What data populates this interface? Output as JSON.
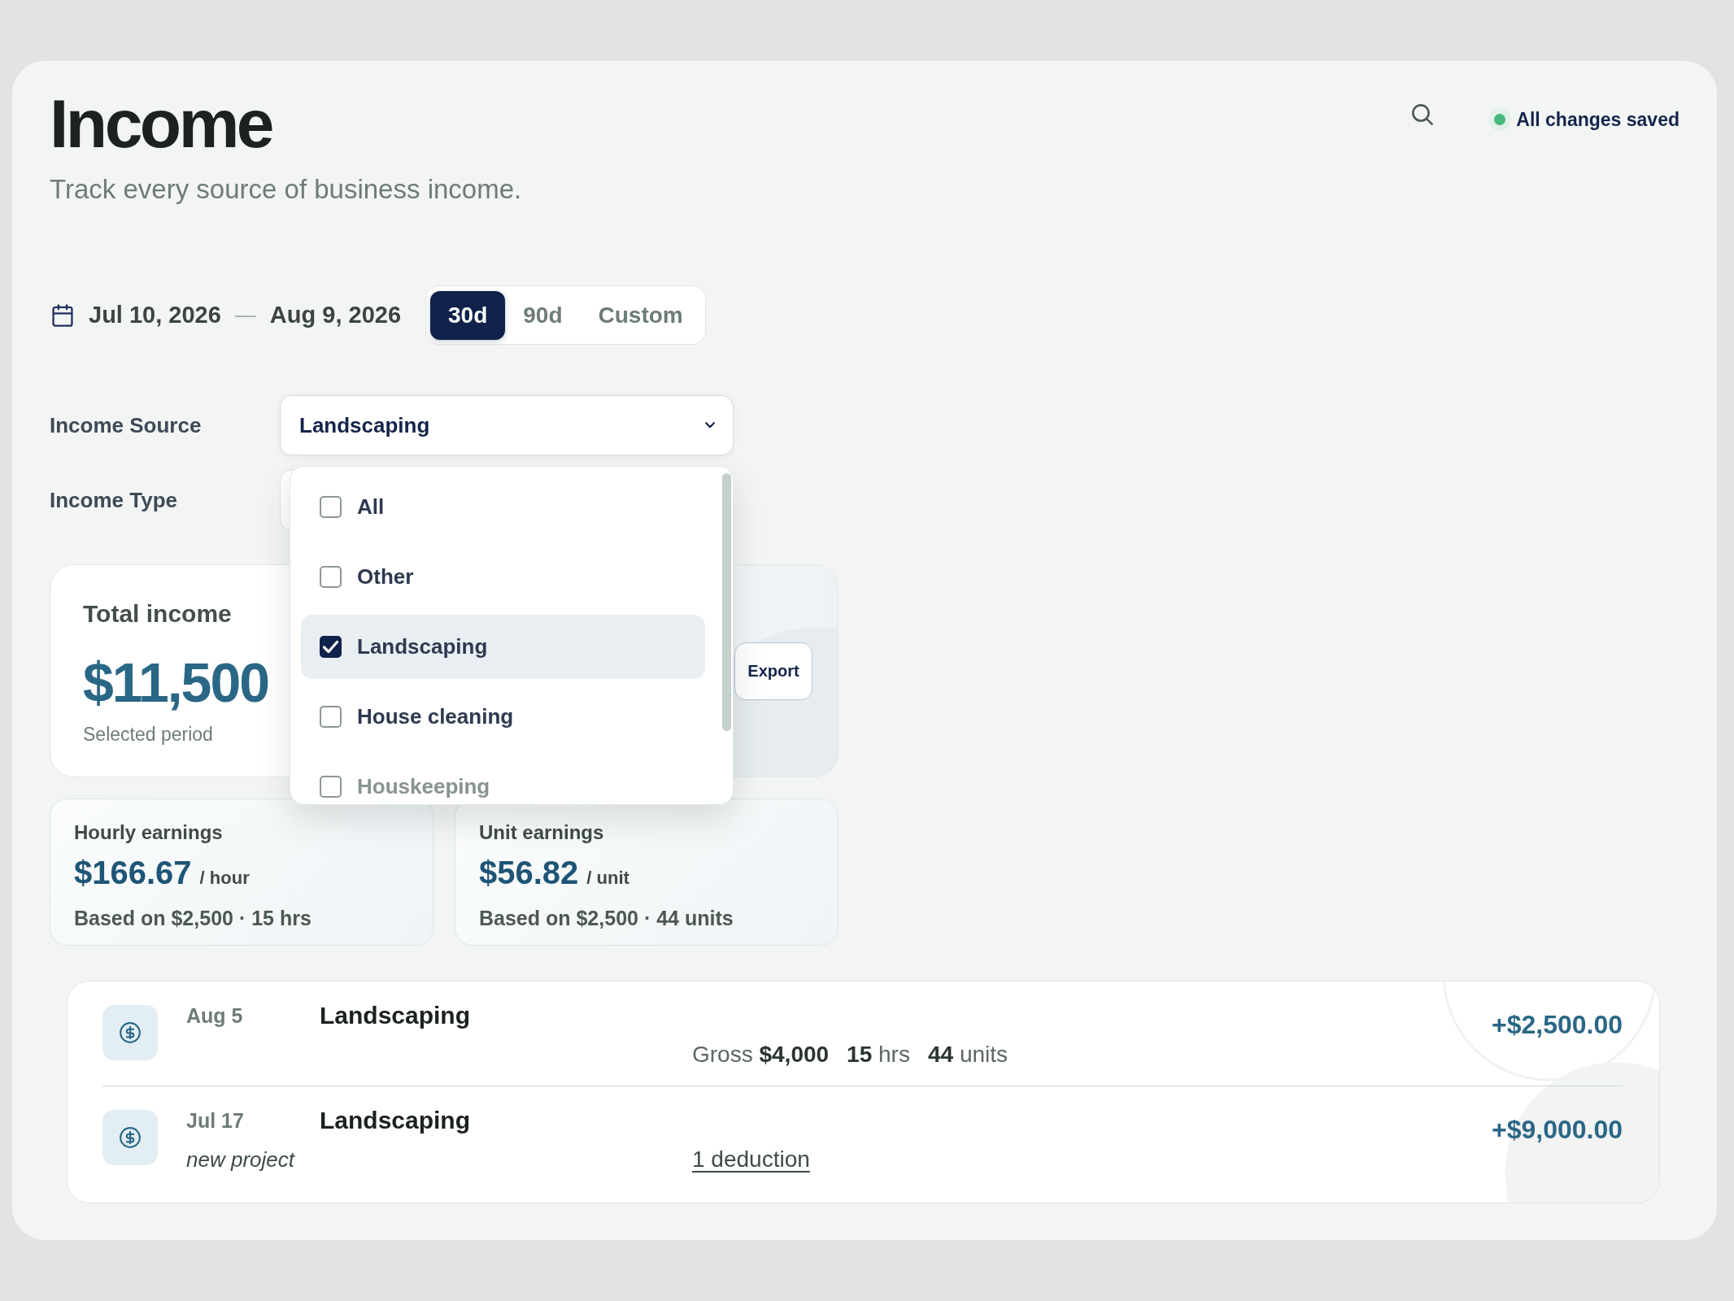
{
  "header": {
    "title": "Income",
    "subtitle": "Track every source of business income.",
    "save_status": "All changes saved"
  },
  "date_range": {
    "start": "Jul 10, 2026",
    "separator": "—",
    "end": "Aug 9, 2026"
  },
  "period_tabs": [
    {
      "label": "30d",
      "selected": true
    },
    {
      "label": "90d",
      "selected": false
    },
    {
      "label": "Custom",
      "selected": false
    }
  ],
  "filters": [
    {
      "label": "Income Source",
      "value": "Landscaping",
      "expanded": true,
      "options": [
        {
          "label": "All",
          "checked": false
        },
        {
          "label": "Other",
          "checked": false
        },
        {
          "label": "Landscaping",
          "checked": true
        },
        {
          "label": "House cleaning",
          "checked": false
        },
        {
          "label": "Houskeeping",
          "checked": false
        }
      ]
    },
    {
      "label": "Income Type"
    }
  ],
  "total_income": {
    "title": "Total income",
    "amount": "$11,500",
    "caption": "Selected period",
    "export_button": "Export"
  },
  "metrics": [
    {
      "title": "Hourly earnings",
      "value": "$166.67",
      "unit": "/ hour",
      "basis": "Based on $2,500 · 15 hrs"
    },
    {
      "title": "Unit earnings",
      "value": "$56.82",
      "unit": "/ unit",
      "basis": "Based on $2,500 · 44 units"
    }
  ],
  "transactions": [
    {
      "date": "Aug 5",
      "name": "Landscaping",
      "details": [
        "Gross **$4,000**",
        "**15** hrs",
        "**44** units"
      ],
      "amount": "+$2,500.00"
    },
    {
      "date": "Jul 17",
      "note": "new project",
      "name": "Landscaping",
      "link": "1 deduction",
      "amount": "+$9,000.00"
    }
  ]
}
